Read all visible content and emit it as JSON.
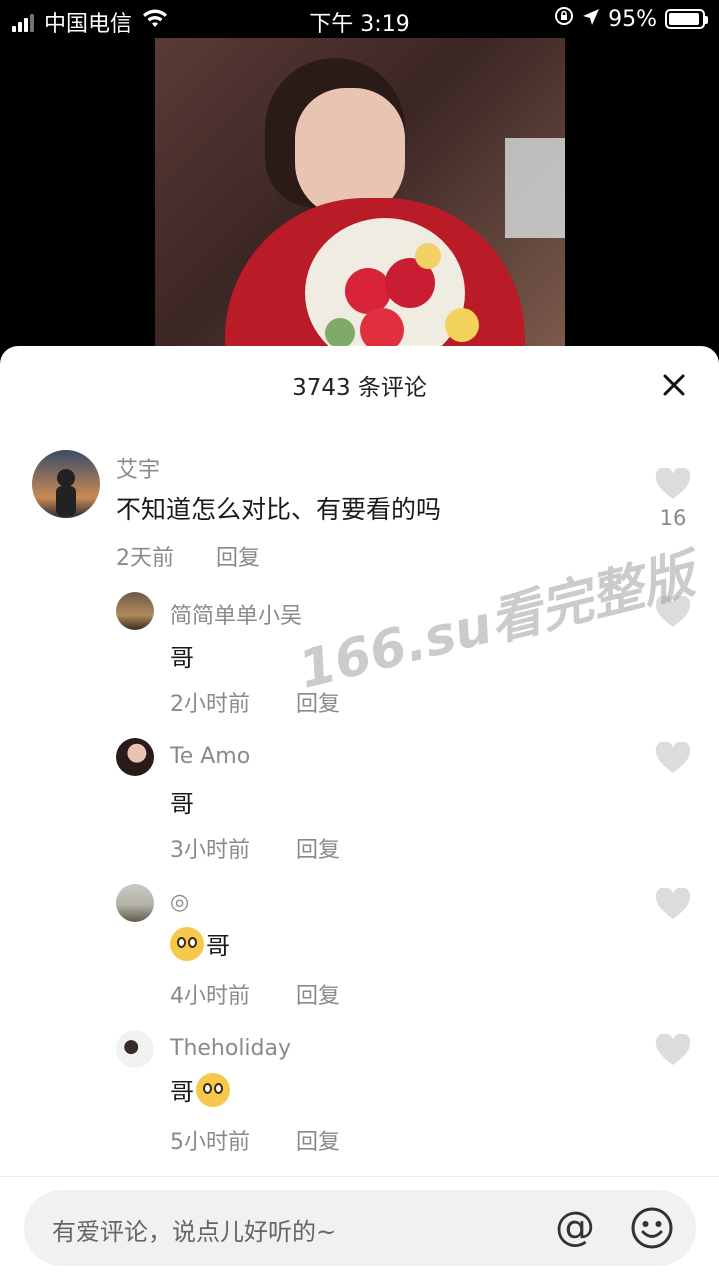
{
  "status_bar": {
    "carrier": "中国电信",
    "time": "下午 3:19",
    "battery": "95%",
    "battery_level": 0.95,
    "icons": [
      "signal-icon",
      "wifi-icon",
      "rotation-lock-icon",
      "location-icon",
      "battery-icon"
    ]
  },
  "sheet": {
    "title": "3743 条评论",
    "close_icon": "close-icon"
  },
  "comments": [
    {
      "user": "艾宇",
      "text": "不知道怎么对比、有要看的吗",
      "time": "2天前",
      "reply": "回复",
      "likes": "16"
    },
    {
      "user": "简简单单小吴",
      "text": "哥",
      "time": "2小时前",
      "reply": "回复"
    },
    {
      "user": "Te Amo",
      "text": "哥",
      "time": "3小时前",
      "reply": "回复"
    },
    {
      "user": "◎",
      "text": "哥",
      "time": "4小时前",
      "reply": "回复",
      "emoji_before": "pleading-face-emoji"
    },
    {
      "user": "Theholiday",
      "text": "哥",
      "time": "5小时前",
      "reply": "回复",
      "emoji_after": "pleading-face-emoji"
    }
  ],
  "watermark": "166.su看完整版",
  "input": {
    "placeholder": "有爱评论，说点儿好听的~",
    "at_symbol": "@",
    "emoji_icon": "smiley-icon"
  },
  "colors": {
    "sheet_bg": "#ffffff",
    "muted_text": "#8a8a8a",
    "like_icon": "#dcdcdc",
    "input_bg": "#f1f1f1"
  }
}
